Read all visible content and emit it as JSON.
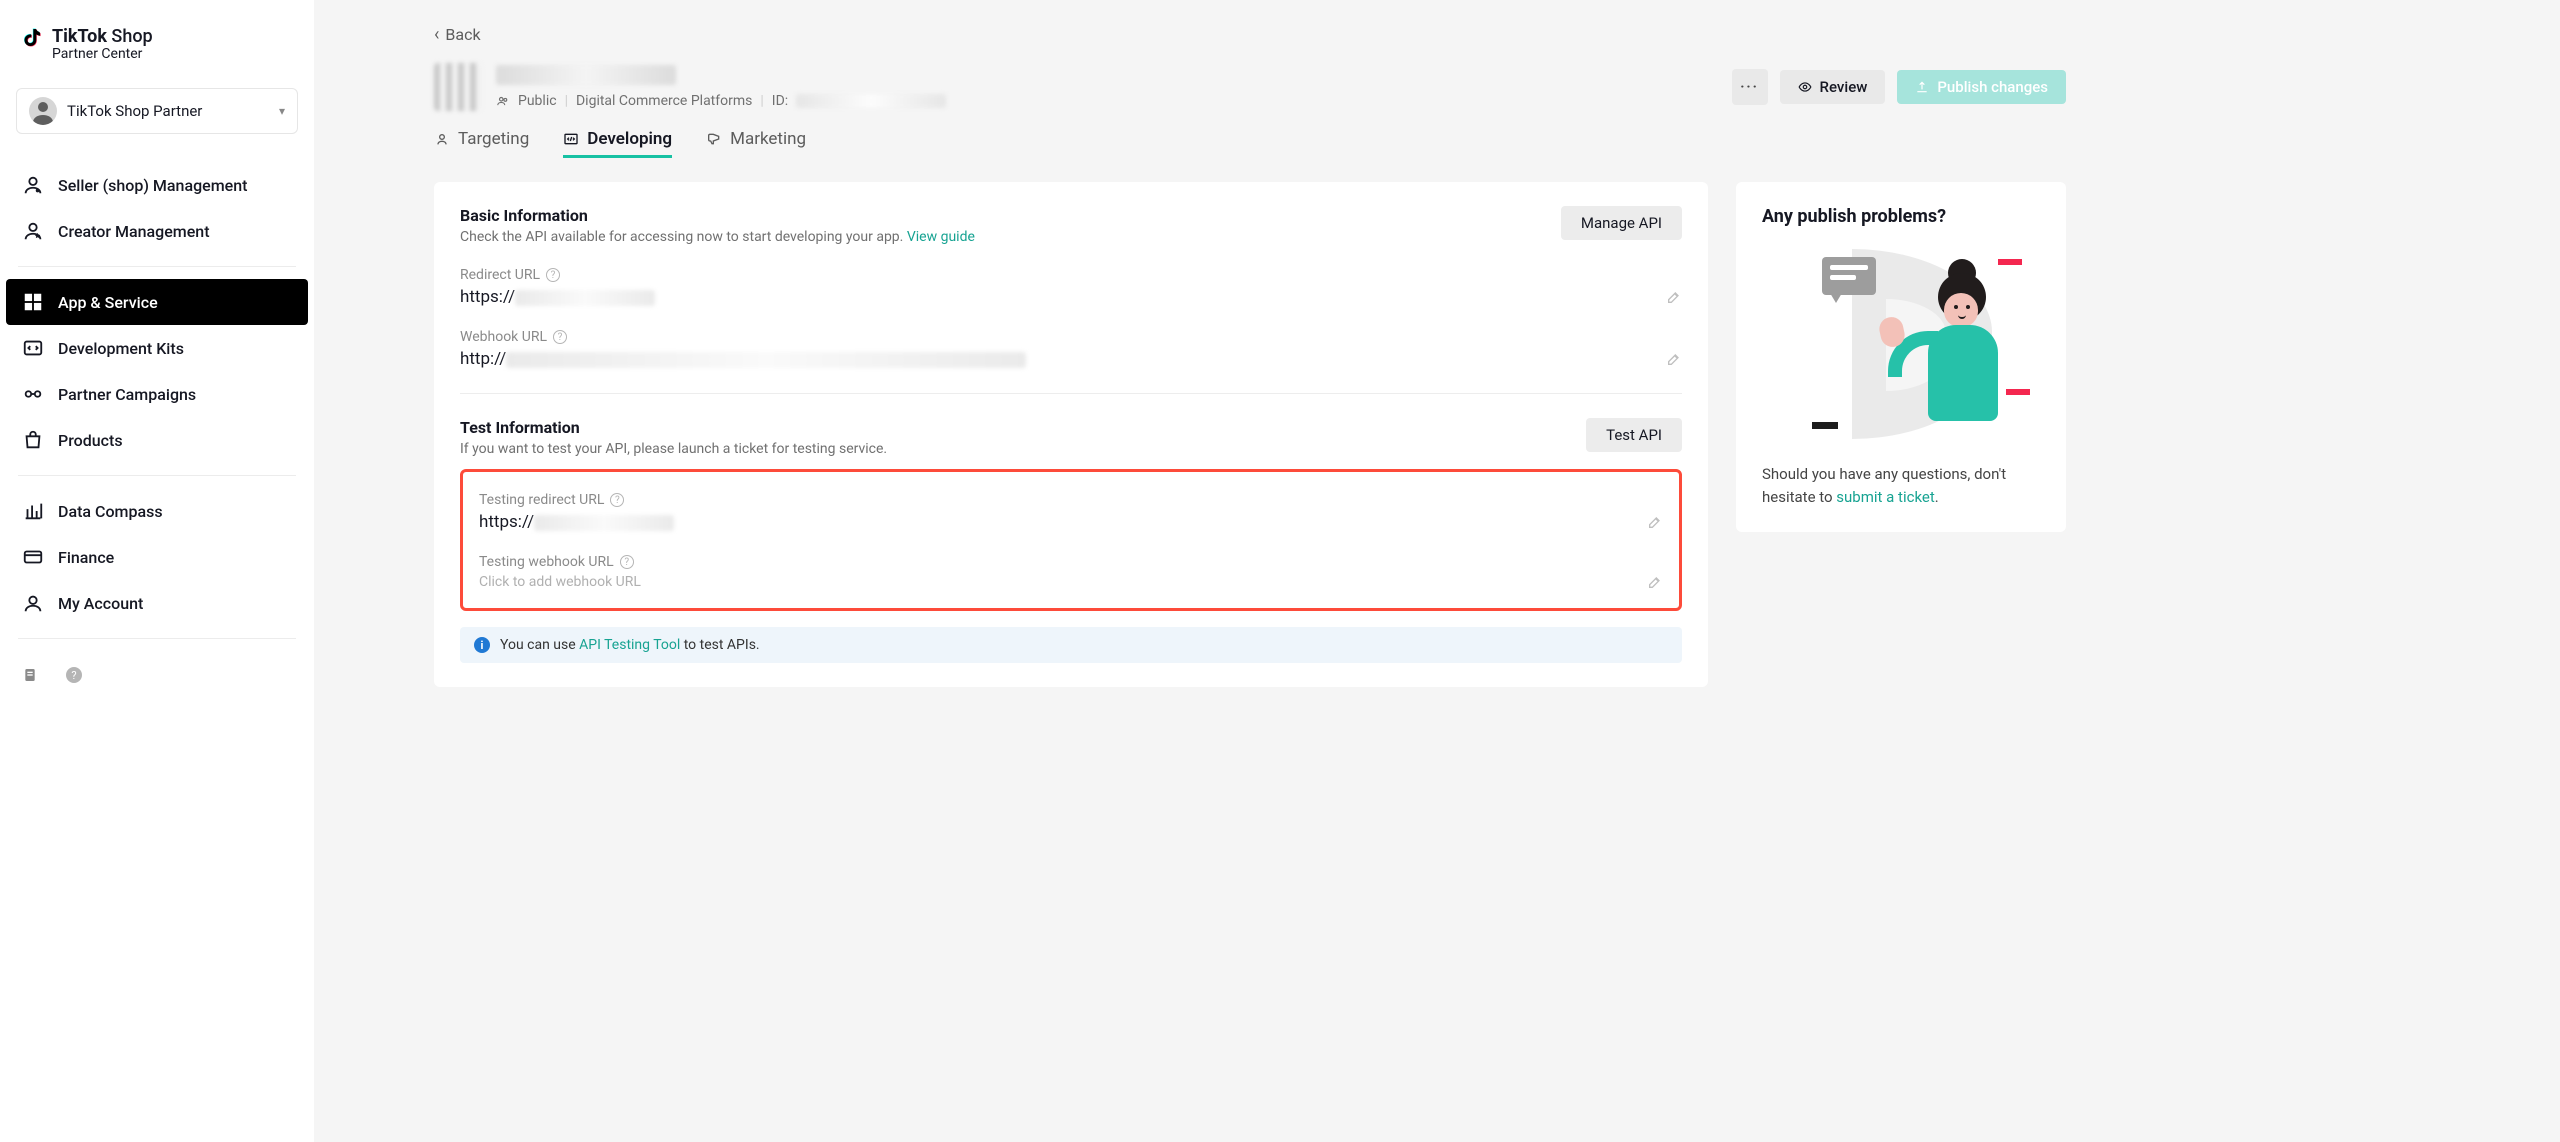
{
  "logo": {
    "brand": "TikTok",
    "shop": " Shop",
    "sub": "Partner Center"
  },
  "partner": {
    "name": "TikTok Shop Partner"
  },
  "nav": {
    "seller": "Seller (shop) Management",
    "creator": "Creator Management",
    "app": "App & Service",
    "kits": "Development Kits",
    "campaigns": "Partner Campaigns",
    "products": "Products",
    "compass": "Data Compass",
    "finance": "Finance",
    "account": "My Account"
  },
  "back": "Back",
  "app_meta": {
    "visibility": "Public",
    "category": "Digital Commerce Platforms",
    "id_label": "ID:"
  },
  "actions": {
    "review": "Review",
    "publish": "Publish changes"
  },
  "tabs": {
    "targeting": "Targeting",
    "developing": "Developing",
    "marketing": "Marketing"
  },
  "basic": {
    "title": "Basic Information",
    "sub": "Check the API available for accessing now to start developing your app.",
    "guide": "View guide",
    "manage": "Manage API",
    "redirect_label": "Redirect URL",
    "redirect_value": "https://",
    "webhook_label": "Webhook URL",
    "webhook_value": "http://"
  },
  "test": {
    "title": "Test Information",
    "sub": "If you want to test your API, please launch a ticket for testing service.",
    "btn": "Test API",
    "redirect_label": "Testing redirect URL",
    "redirect_value": "https://",
    "webhook_label": "Testing webhook URL",
    "webhook_placeholder": "Click to add webhook URL"
  },
  "banner": {
    "pre": "You can use ",
    "link": "API Testing Tool",
    "post": " to test APIs."
  },
  "side": {
    "title": "Any publish problems?",
    "text_pre": "Should you have any questions, don't hesitate to ",
    "link": "submit a ticket",
    "text_post": "."
  }
}
